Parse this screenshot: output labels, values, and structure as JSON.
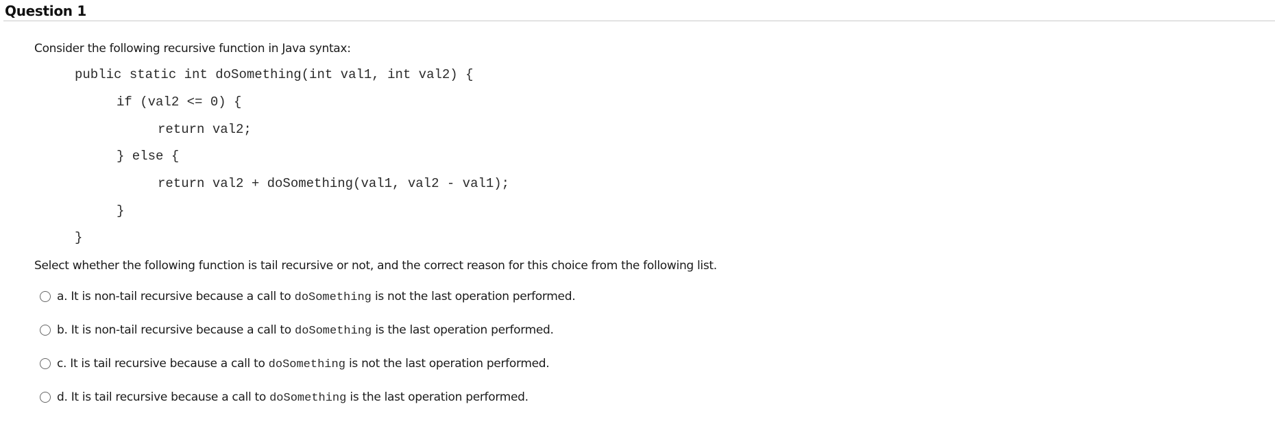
{
  "question": {
    "title": "Question 1",
    "prompt": "Consider the following recursive function in Java syntax:",
    "code_lines": [
      "public static int doSomething(int val1, int val2) {",
      "if (val2 <= 0) {",
      "return val2;",
      "} else {",
      "return val2 + doSomething(val1, val2 - val1);",
      "}",
      "}"
    ],
    "instruction": "Select whether the following function is tail recursive or not, and the correct reason for this choice from the following list.",
    "options": [
      {
        "pre": "a. It is non-tail recursive because a call to ",
        "code": "doSomething",
        "post": " is not the last operation performed.",
        "selected": false
      },
      {
        "pre": "b. It is non-tail recursive because a call to ",
        "code": "doSomething",
        "post": " is the last operation performed.",
        "selected": false
      },
      {
        "pre": "c. It is tail recursive because a call to ",
        "code": "doSomething",
        "post": " is not the last operation performed.",
        "selected": false
      },
      {
        "pre": "d. It is tail recursive because a call to ",
        "code": "doSomething",
        "post": " is the last operation performed.",
        "selected": false
      }
    ]
  }
}
